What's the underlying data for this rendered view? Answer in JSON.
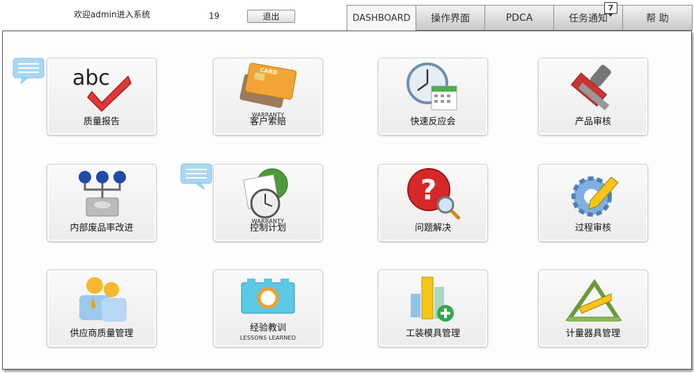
{
  "header": {
    "welcome_text": "欢迎admin进入系统",
    "count": "19",
    "logout_label": "退出"
  },
  "tabs": [
    {
      "label": "DASHBOARD",
      "active": true
    },
    {
      "label": "操作界面"
    },
    {
      "label": "PDCA"
    },
    {
      "label": "任务通知",
      "badge": "7"
    },
    {
      "label": "帮 助"
    }
  ],
  "tiles": [
    {
      "label": "质量报告",
      "icon": "abc-checkmark-icon"
    },
    {
      "label": "客户索赔",
      "sub": "WARRANTY",
      "icon": "credit-card-icon"
    },
    {
      "label": "快速反应会",
      "icon": "clock-calendar-icon"
    },
    {
      "label": "产品审核",
      "icon": "stamp-icon"
    },
    {
      "label": "内部废品率改进",
      "icon": "network-drive-icon"
    },
    {
      "label": "控制计划",
      "sub": "WARRANTY",
      "icon": "schedule-clock-icon"
    },
    {
      "label": "问题解决",
      "icon": "question-magnifier-icon"
    },
    {
      "label": "过程审核",
      "icon": "gear-pencil-icon"
    },
    {
      "label": "供应商质量管理",
      "icon": "users-group-icon"
    },
    {
      "label": "经验教训",
      "sub": "LESSONS LEARNED",
      "icon": "lifebuoy-block-icon"
    },
    {
      "label": "工装模具管理",
      "icon": "bar-chart-add-icon"
    },
    {
      "label": "计量器具管理",
      "icon": "ruler-triangle-icon"
    }
  ]
}
